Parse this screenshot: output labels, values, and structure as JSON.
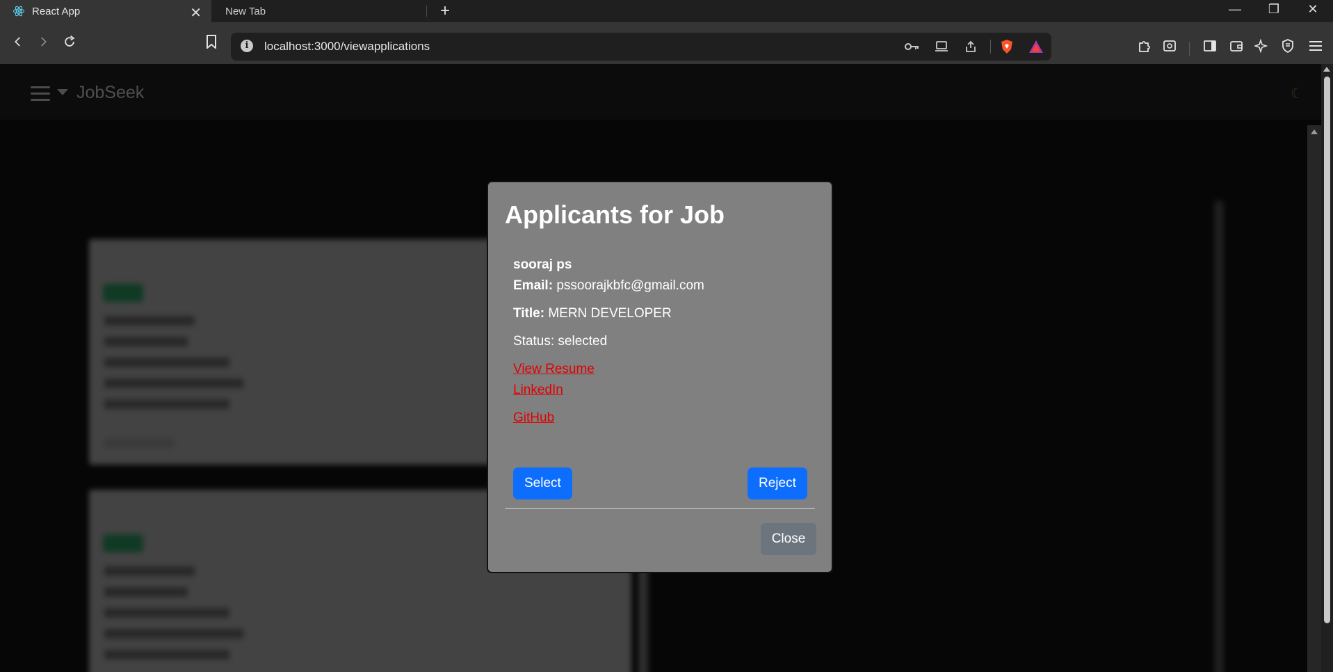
{
  "browser": {
    "tabs": [
      {
        "title": "React App",
        "active": true
      },
      {
        "title": "New Tab",
        "active": false
      }
    ],
    "url": "localhost:3000/viewapplications"
  },
  "app": {
    "brand": "JobSeek"
  },
  "modal": {
    "title": "Applicants for Job",
    "applicant": {
      "name": "sooraj ps",
      "email_label": "Email:",
      "email": "pssoorajkbfc@gmail.com",
      "title_label": "Title:",
      "title": "MERN DEVELOPER",
      "status": "Status: selected",
      "resume_link": "View Resume",
      "linkedin_link": "LinkedIn",
      "github_link": "GitHub"
    },
    "select_label": "Select",
    "reject_label": "Reject",
    "close_label": "Close"
  },
  "colors": {
    "primary": "#0d6efd",
    "secondary": "#6c757d",
    "link": "#e00000",
    "modal_bg": "#808080"
  }
}
